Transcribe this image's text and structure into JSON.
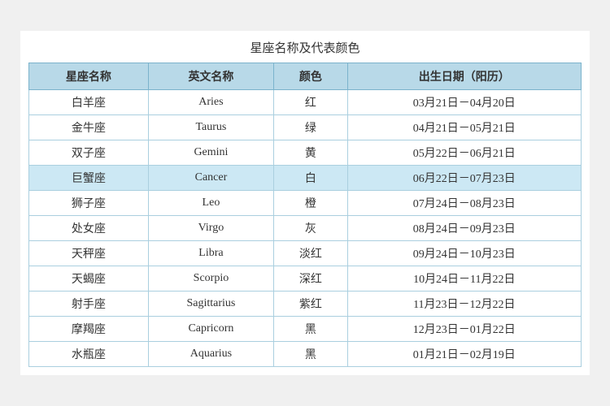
{
  "title": "星座名称及代表颜色",
  "table": {
    "headers": [
      "星座名称",
      "英文名称",
      "颜色",
      "出生日期（阳历）"
    ],
    "rows": [
      {
        "chinese": "白羊座",
        "english": "Aries",
        "color": "红",
        "dates": "03月21日－04月20日",
        "highlight": false
      },
      {
        "chinese": "金牛座",
        "english": "Taurus",
        "color": "绿",
        "dates": "04月21日－05月21日",
        "highlight": false
      },
      {
        "chinese": "双子座",
        "english": "Gemini",
        "color": "黄",
        "dates": "05月22日－06月21日",
        "highlight": false
      },
      {
        "chinese": "巨蟹座",
        "english": "Cancer",
        "color": "白",
        "dates": "06月22日－07月23日",
        "highlight": true
      },
      {
        "chinese": "狮子座",
        "english": "Leo",
        "color": "橙",
        "dates": "07月24日－08月23日",
        "highlight": false
      },
      {
        "chinese": "处女座",
        "english": "Virgo",
        "color": "灰",
        "dates": "08月24日－09月23日",
        "highlight": false
      },
      {
        "chinese": "天秤座",
        "english": "Libra",
        "color": "淡红",
        "dates": "09月24日－10月23日",
        "highlight": false
      },
      {
        "chinese": "天蝎座",
        "english": "Scorpio",
        "color": "深红",
        "dates": "10月24日－11月22日",
        "highlight": false
      },
      {
        "chinese": "射手座",
        "english": "Sagittarius",
        "color": "紫红",
        "dates": "11月23日－12月22日",
        "highlight": false
      },
      {
        "chinese": "摩羯座",
        "english": "Capricorn",
        "color": "黑",
        "dates": "12月23日－01月22日",
        "highlight": false
      },
      {
        "chinese": "水瓶座",
        "english": "Aquarius",
        "color": "黑",
        "dates": "01月21日－02月19日",
        "highlight": false
      }
    ]
  }
}
